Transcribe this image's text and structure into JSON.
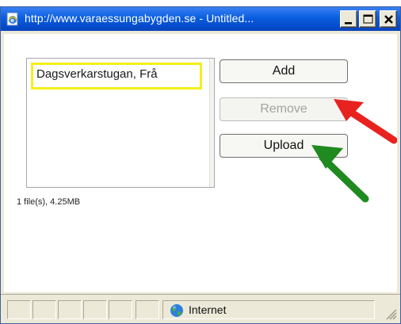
{
  "window": {
    "title": "http://www.varaessungabygden.se - Untitled..."
  },
  "file_list": {
    "items": [
      "Dagsverkarstugan, Frå"
    ]
  },
  "buttons": {
    "add": "Add",
    "remove": "Remove",
    "upload": "Upload"
  },
  "file_info": "1 file(s), 4.25MB",
  "statusbar": {
    "zone": "Internet"
  },
  "colors": {
    "highlight_box": "#f5ef1a",
    "arrow_red": "#e8221e",
    "arrow_green": "#1f8a1f"
  },
  "icons": {
    "app": "ie-page-icon",
    "zone": "globe-icon",
    "minimize": "minimize-icon",
    "maximize": "maximize-icon",
    "close": "close-icon"
  }
}
